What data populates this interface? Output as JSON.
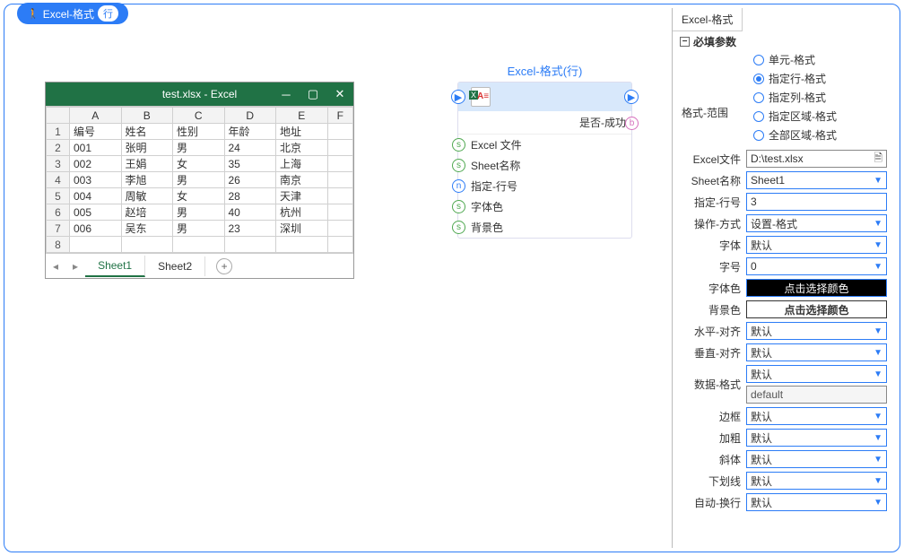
{
  "header": {
    "badge_label": "Excel-格式",
    "badge_row": "行"
  },
  "excel_window": {
    "title": "test.xlsx  -  Excel",
    "columns": [
      "",
      "A",
      "B",
      "C",
      "D",
      "E",
      "F"
    ],
    "rows": [
      {
        "n": "1",
        "cells": [
          "编号",
          "姓名",
          "性别",
          "年龄",
          "地址",
          ""
        ]
      },
      {
        "n": "2",
        "cells": [
          "001",
          "张明",
          "男",
          "24",
          "北京",
          ""
        ]
      },
      {
        "n": "3",
        "cells": [
          "002",
          "王娟",
          "女",
          "35",
          "上海",
          ""
        ]
      },
      {
        "n": "4",
        "cells": [
          "003",
          "李旭",
          "男",
          "26",
          "南京",
          ""
        ]
      },
      {
        "n": "5",
        "cells": [
          "004",
          "周敏",
          "女",
          "28",
          "天津",
          ""
        ]
      },
      {
        "n": "6",
        "cells": [
          "005",
          "赵培",
          "男",
          "40",
          "杭州",
          ""
        ]
      },
      {
        "n": "7",
        "cells": [
          "006",
          "吴东",
          "男",
          "23",
          "深圳",
          ""
        ]
      },
      {
        "n": "8",
        "cells": [
          "",
          "",
          "",
          "",
          "",
          ""
        ]
      }
    ],
    "tabs": [
      "Sheet1",
      "Sheet2"
    ]
  },
  "node": {
    "title": "Excel-格式(行)",
    "output": "是否-成功",
    "inputs": [
      {
        "type": "s",
        "label": "Excel 文件"
      },
      {
        "type": "s",
        "label": "Sheet名称"
      },
      {
        "type": "n",
        "label": "指定-行号"
      },
      {
        "type": "s",
        "label": "字体色"
      },
      {
        "type": "s",
        "label": "背景色"
      }
    ]
  },
  "panel": {
    "tab_title": "Excel-格式",
    "section_title": "必填参数",
    "scope_label": "格式-范围",
    "radios": [
      {
        "label": "单元-格式",
        "checked": false
      },
      {
        "label": "指定行-格式",
        "checked": true
      },
      {
        "label": "指定列-格式",
        "checked": false
      },
      {
        "label": "指定区域-格式",
        "checked": false
      },
      {
        "label": "全部区域-格式",
        "checked": false
      }
    ],
    "props": {
      "excel_file": {
        "label": "Excel文件",
        "value": "D:\\test.xlsx"
      },
      "sheet_name": {
        "label": "Sheet名称",
        "value": "Sheet1"
      },
      "row_no": {
        "label": "指定-行号",
        "value": "3"
      },
      "operation": {
        "label": "操作-方式",
        "value": "设置-格式"
      },
      "font": {
        "label": "字体",
        "value": "默认"
      },
      "font_size": {
        "label": "字号",
        "value": "0"
      },
      "font_color": {
        "label": "字体色",
        "value": "点击选择颜色"
      },
      "bg_color": {
        "label": "背景色",
        "value": "点击选择颜色"
      },
      "h_align": {
        "label": "水平-对齐",
        "value": "默认"
      },
      "v_align": {
        "label": "垂直-对齐",
        "value": "默认"
      },
      "data_format": {
        "label": "数据-格式",
        "value": "默认",
        "value2": "default"
      },
      "border": {
        "label": "边框",
        "value": "默认"
      },
      "bold": {
        "label": "加粗",
        "value": "默认"
      },
      "italic": {
        "label": "斜体",
        "value": "默认"
      },
      "underline": {
        "label": "下划线",
        "value": "默认"
      },
      "wrap": {
        "label": "自动-换行",
        "value": "默认"
      }
    }
  }
}
